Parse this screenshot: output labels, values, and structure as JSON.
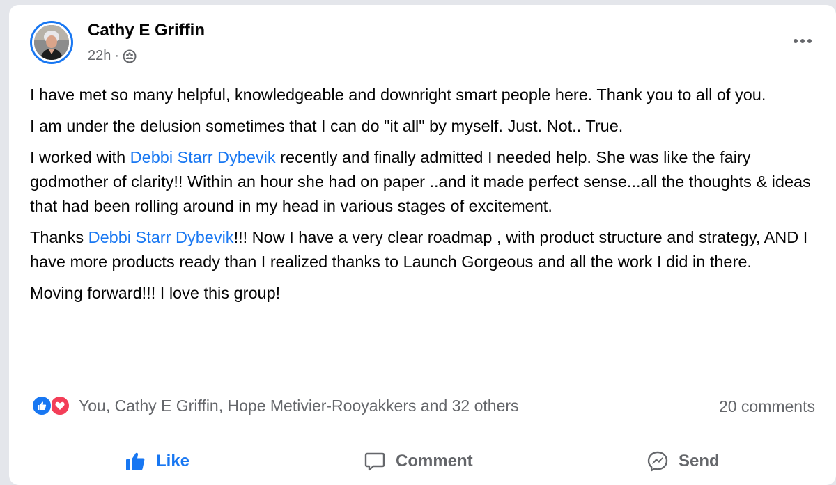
{
  "post": {
    "author": "Cathy E Griffin",
    "time": "22h",
    "separator": "·",
    "audience_icon": "group-icon",
    "more_icon": "more-horizontal-icon"
  },
  "content": {
    "p1": "I have met so many helpful, knowledgeable and downright smart people here.  Thank you to all of you.",
    "p2": "I am under the delusion sometimes that I can do \"it all\" by myself.  Just.  Not.. True.",
    "p3_a": "I worked with ",
    "p3_mention": "Debbi Starr Dybevik",
    "p3_b": " recently and finally admitted I needed help.  She was like the fairy godmother of clarity!!    Within an hour she had on paper ..and it made perfect sense...all the thoughts & ideas that had been rolling around in my head in various stages of excitement.",
    "p4_a": "Thanks ",
    "p4_mention": "Debbi Starr Dybevik",
    "p4_b": "!!!  Now I have a very clear roadmap , with product structure and strategy, AND I have more products ready than I realized thanks to Launch Gorgeous and all the work I did in there.",
    "p5": "Moving forward!!! I love this group!"
  },
  "reactions": {
    "icons": [
      "like-reaction-icon",
      "love-reaction-icon"
    ],
    "summary": "You, Cathy E Griffin, Hope Metivier-Rooyakkers and 32 others",
    "comments": "20 comments"
  },
  "actions": {
    "like": "Like",
    "comment": "Comment",
    "send": "Send"
  },
  "colors": {
    "accent": "#1877f2",
    "love": "#f33e58",
    "secondary_text": "#65676b"
  }
}
